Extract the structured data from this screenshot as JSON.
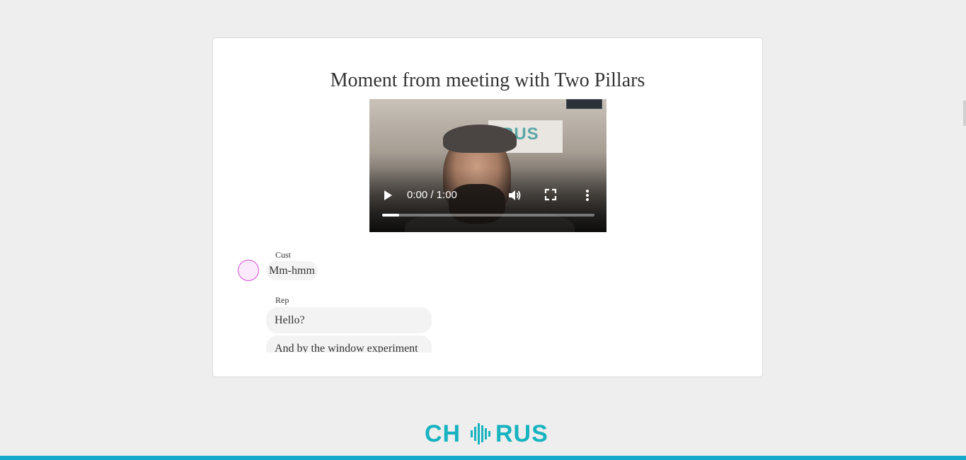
{
  "page": {
    "title": "Moment from meeting with Two Pillars"
  },
  "video": {
    "background_sign_text": "RUS",
    "time": "0:00 / 1:00",
    "progress_fraction": 0.08,
    "icons": {
      "play": "play-icon",
      "volume": "volume-icon",
      "fullscreen": "fullscreen-icon",
      "more": "more-vertical-icon"
    }
  },
  "transcript": {
    "entries": [
      {
        "speaker": "Cust",
        "avatar_color": "#fbeafb",
        "avatar_border": "#d54fd5",
        "messages": [
          "Mm-hmm"
        ]
      },
      {
        "speaker": "Rep",
        "messages": [
          "Hello?",
          "And by the window experiment"
        ]
      }
    ]
  },
  "footer": {
    "logo_prefix": "CH",
    "logo_suffix": "RUS",
    "brand_color": "#17b3c0",
    "bar_color": "#17a9cc"
  }
}
